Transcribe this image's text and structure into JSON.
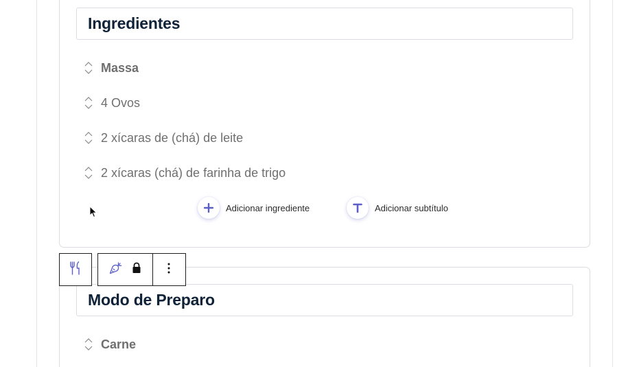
{
  "ingredients_block": {
    "title": "Ingredientes",
    "items": [
      {
        "text": "Massa",
        "type": "subtitle"
      },
      {
        "text": "4 Ovos",
        "type": "ingredient"
      },
      {
        "text": "2 xícaras de (chá) de leite",
        "type": "ingredient"
      },
      {
        "text": "2 xícaras (chá) de farinha de trigo",
        "type": "ingredient"
      }
    ],
    "add_ingredient_label": "Adicionar ingrediente",
    "add_subtitle_label": "Adicionar subtítulo"
  },
  "prep_block": {
    "title": "Modo de Preparo",
    "items": [
      {
        "text": "Carne",
        "type": "subtitle"
      }
    ]
  },
  "block_toolbar": {
    "icons": [
      "fork-knife-icon",
      "carrot-icon",
      "lock-icon",
      "more-vertical-icon"
    ]
  },
  "colors": {
    "accent": "#5b5fc7",
    "title_text": "#0f2238",
    "item_text": "#6f6f6f",
    "border": "#dcdce2"
  }
}
